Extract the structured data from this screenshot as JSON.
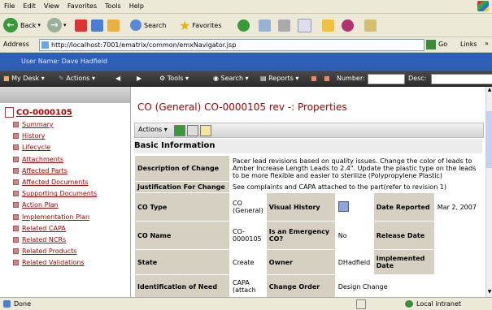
{
  "browser": {
    "menu": [
      "File",
      "Edit",
      "View",
      "Favorites",
      "Tools",
      "Help"
    ],
    "toolbar": {
      "back": "Back",
      "search": "Search",
      "favorites": "Favorites"
    },
    "address_label": "Address",
    "url": "http://localhost:7001/ematrix/common/emxNavigator.jsp",
    "go": "Go",
    "links": "Links",
    "more": "»"
  },
  "app": {
    "user": "User Name: Dave Hadfield",
    "menubar": {
      "my_desk": "My Desk",
      "actions": "Actions",
      "tools": "Tools",
      "search": "Search",
      "reports": "Reports",
      "number": "Number:",
      "desc": "Desc:"
    }
  },
  "nav": {
    "header": "CO-0000105",
    "items": [
      "Summary",
      "History",
      "Lifecycle",
      "Attachments",
      "Affected Parts",
      "Affected Documents",
      "Supporting Documents",
      "Action Plan",
      "Implementation Plan",
      "Related CAPA",
      "Related NCRs",
      "Related Products",
      "Related Validations"
    ]
  },
  "main": {
    "title": "CO (General) CO-0000105 rev -: Properties",
    "actions": "Actions",
    "section": "Basic Information",
    "rows": {
      "desc_label": "Description of Change",
      "desc_value": "Pacer lead revisions based on quality issues. Change the color of leads to Amber Increase Length Leads to 2.4\". Update the plastic type on the leads to be more flexible and easier to sterilize (Polypropylene Plastic)",
      "just_label": "Justification For Change",
      "just_value": "See complaints and CAPA attached to the part(refer to revision 1)",
      "cotype_label": "CO Type",
      "cotype_value": "CO (General)",
      "visual_label": "Visual History",
      "date_label": "Date Reported",
      "date_value": "Mar 2, 2007",
      "coname_label": "CO Name",
      "coname_value": "CO-0000105",
      "emerg_label": "Is an Emergency CO?",
      "emerg_value": "No",
      "release_label": "Release Date",
      "release_value": "",
      "state_label": "State",
      "state_value": "Create",
      "owner_label": "Owner",
      "owner_value": "DHadfield",
      "impl_label": "Implemented Date",
      "impl_value": "",
      "ident_label": "Identification of Need",
      "ident_value": "CAPA (attach",
      "order_label": "Change Order",
      "order_value": "Design Change"
    }
  },
  "status": {
    "left": "Done",
    "zone": "Local intranet"
  },
  "colors": {
    "accent": "#a00000",
    "header_blue": "#2d5fb4",
    "label_bg": "#d6d0c2"
  }
}
